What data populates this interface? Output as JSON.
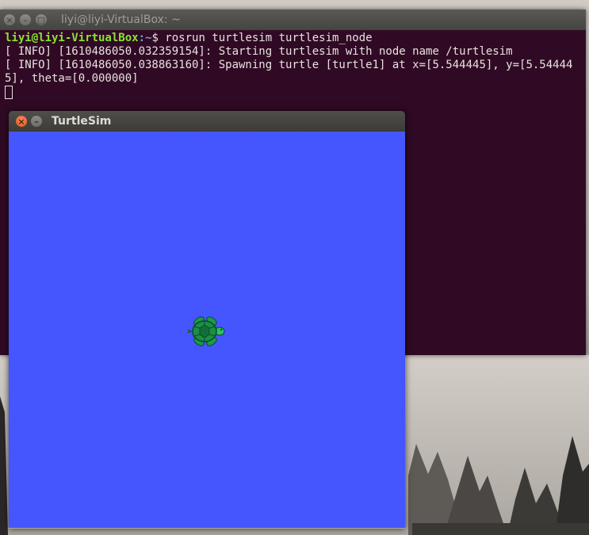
{
  "terminal": {
    "title": "liyi@liyi-VirtualBox: ~",
    "prompt_user": "liyi@liyi-VirtualBox",
    "prompt_path": ":~",
    "prompt_symbol": "$ ",
    "command": "rosrun turtlesim turtlesim_node",
    "log_lines": [
      "[ INFO] [1610486050.032359154]: Starting turtlesim with node name /turtlesim",
      "[ INFO] [1610486050.038863160]: Spawning turtle [turtle1] at x=[5.544445], y=[5.544445], theta=[0.000000]"
    ],
    "colors": {
      "background": "#300a24",
      "user": "#8ae234",
      "path": "#729fcf",
      "text": "#e8e2df"
    }
  },
  "turtlesim": {
    "title": "TurtleSim",
    "background_color": "#4556ff",
    "turtle_icon": "turtle-icon"
  }
}
